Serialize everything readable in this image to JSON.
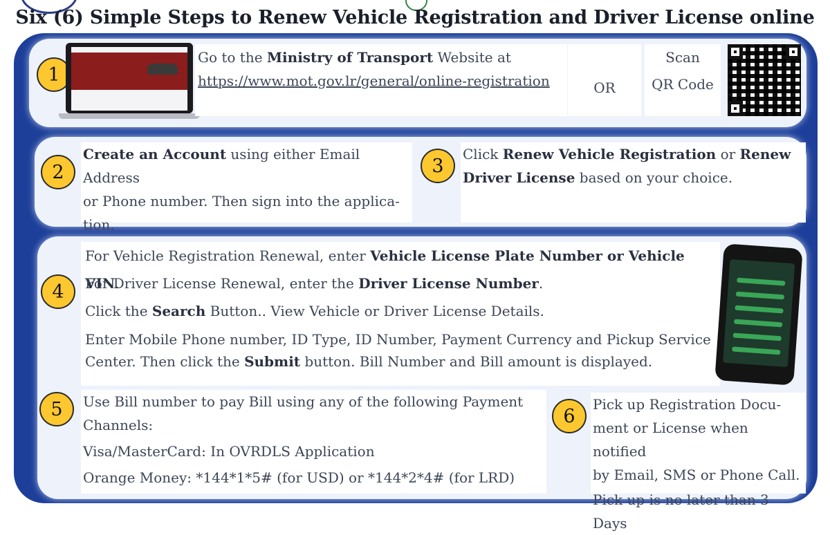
{
  "title": "Six (6) Simple Steps to Renew Vehicle Registration and Driver License online",
  "step1": {
    "number": "1",
    "text_pre": "Go to the ",
    "text_bold": "Ministry of Transport",
    "text_post": " Website at",
    "url": "https://www.mot.gov.lr/general/online-registration",
    "or": "OR",
    "scan_line1": "Scan",
    "scan_line2": "QR Code"
  },
  "step2": {
    "number": "2",
    "bold": "Create an Account",
    "line1_rest": " using either Email Address",
    "line2": "or Phone number. Then sign into the applica-",
    "line3": "tion."
  },
  "step3": {
    "number": "3",
    "pre": "Click ",
    "bold1": "Renew Vehicle Registration",
    "mid": " or ",
    "bold2a": "Renew",
    "bold2b": "Driver License",
    "post": " based on your choice."
  },
  "step4": {
    "number": "4",
    "l1_pre": "For Vehicle Registration Renewal, enter ",
    "l1_bold": "Vehicle License Plate Number or Vehicle VIN",
    "l1_post": ".",
    "l2_pre": "For Driver License Renewal, enter the ",
    "l2_bold": "Driver License Number",
    "l2_post": ".",
    "l3_pre": "Click the ",
    "l3_bold": "Search",
    "l3_post": " Button.. View Vehicle or Driver License Details.",
    "l4": "Enter Mobile Phone number,  ID Type, ID Number,  Payment Currency and Pickup Service",
    "l5_pre": "Center. Then click the ",
    "l5_bold": "Submit",
    "l5_post": " button. Bill Number and Bill amount is displayed."
  },
  "step5": {
    "number": "5",
    "l1": "Use Bill number to pay Bill using any of the following Payment",
    "l2": "Channels:",
    "l3": "Visa/MasterCard: In OVRDLS Application",
    "l4": "Orange Money: *144*1*5# (for USD) or  *144*2*4# (for LRD)"
  },
  "step6": {
    "number": "6",
    "l1": "Pick up Registration Docu-",
    "l2": "ment or License when notified",
    "l3": "by Email, SMS or Phone Call.",
    "l4": "Pick up is no later than 3 Days"
  },
  "colors": {
    "frame_blue": "#1d3f99",
    "badge_yellow": "#fcc72f",
    "panel_bg": "#eef2fb"
  }
}
